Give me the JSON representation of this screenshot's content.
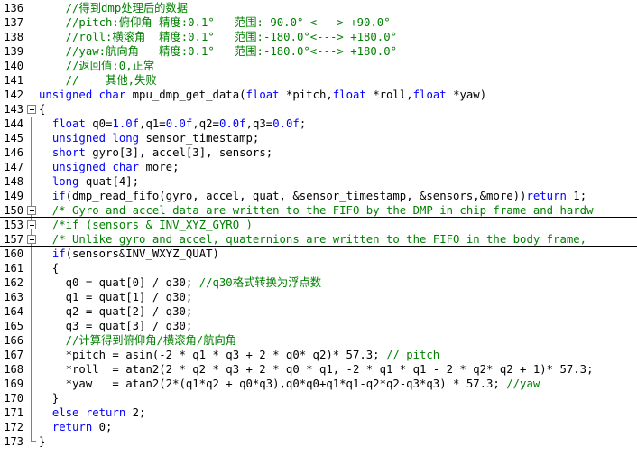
{
  "editor": {
    "lines": [
      {
        "n": "136",
        "fold": "line",
        "tokens": [
          {
            "t": "    //得到dmp处理后的数据",
            "c": "cm"
          }
        ]
      },
      {
        "n": "137",
        "fold": "line",
        "tokens": [
          {
            "t": "    //pitch:俯仰角 精度:0.1°   范围:-90.0° <---> +90.0°",
            "c": "cm"
          }
        ]
      },
      {
        "n": "138",
        "fold": "line",
        "tokens": [
          {
            "t": "    //roll:横滚角  精度:0.1°   范围:-180.0°<---> +180.0°",
            "c": "cm"
          }
        ]
      },
      {
        "n": "139",
        "fold": "line",
        "tokens": [
          {
            "t": "    //yaw:航向角   精度:0.1°   范围:-180.0°<---> +180.0°",
            "c": "cm"
          }
        ]
      },
      {
        "n": "140",
        "fold": "line",
        "tokens": [
          {
            "t": "    //返回值:0,正常",
            "c": "cm"
          }
        ]
      },
      {
        "n": "141",
        "fold": "line",
        "tokens": [
          {
            "t": "    //    其他,失败",
            "c": "cm"
          }
        ]
      },
      {
        "n": "142",
        "fold": "line",
        "tokens": [
          {
            "t": "unsigned char",
            "c": "kw"
          },
          {
            "t": " mpu_dmp_get_data(",
            "c": ""
          },
          {
            "t": "float",
            "c": "kw"
          },
          {
            "t": " *pitch,",
            "c": ""
          },
          {
            "t": "float",
            "c": "kw"
          },
          {
            "t": " *roll,",
            "c": ""
          },
          {
            "t": "float",
            "c": "kw"
          },
          {
            "t": " *yaw)",
            "c": ""
          }
        ]
      },
      {
        "n": "143",
        "fold": "open",
        "tokens": [
          {
            "t": "{",
            "c": ""
          }
        ]
      },
      {
        "n": "144",
        "fold": "line",
        "tokens": [
          {
            "t": "  ",
            "c": ""
          },
          {
            "t": "float",
            "c": "kw"
          },
          {
            "t": " q0=",
            "c": ""
          },
          {
            "t": "1.0f",
            "c": "kw"
          },
          {
            "t": ",q1=",
            "c": ""
          },
          {
            "t": "0.0f",
            "c": "kw"
          },
          {
            "t": ",q2=",
            "c": ""
          },
          {
            "t": "0.0f",
            "c": "kw"
          },
          {
            "t": ",q3=",
            "c": ""
          },
          {
            "t": "0.0f",
            "c": "kw"
          },
          {
            "t": ";",
            "c": ""
          }
        ]
      },
      {
        "n": "145",
        "fold": "line",
        "tokens": [
          {
            "t": "  ",
            "c": ""
          },
          {
            "t": "unsigned long",
            "c": "kw"
          },
          {
            "t": " sensor_timestamp;",
            "c": ""
          }
        ]
      },
      {
        "n": "146",
        "fold": "line",
        "tokens": [
          {
            "t": "  ",
            "c": ""
          },
          {
            "t": "short",
            "c": "kw"
          },
          {
            "t": " gyro[3], accel[3], sensors;",
            "c": ""
          }
        ]
      },
      {
        "n": "147",
        "fold": "line",
        "tokens": [
          {
            "t": "  ",
            "c": ""
          },
          {
            "t": "unsigned char",
            "c": "kw"
          },
          {
            "t": " more;",
            "c": ""
          }
        ]
      },
      {
        "n": "148",
        "fold": "line",
        "tokens": [
          {
            "t": "  ",
            "c": ""
          },
          {
            "t": "long",
            "c": "kw"
          },
          {
            "t": " quat[4];",
            "c": ""
          }
        ]
      },
      {
        "n": "149",
        "fold": "line",
        "tokens": [
          {
            "t": "  ",
            "c": ""
          },
          {
            "t": "if",
            "c": "kw"
          },
          {
            "t": "(dmp_read_fifo(gyro, accel, quat, &sensor_timestamp, &sensors,&more))",
            "c": ""
          },
          {
            "t": "return",
            "c": "kw"
          },
          {
            "t": " 1;",
            "c": ""
          }
        ]
      },
      {
        "n": "150",
        "fold": "closed",
        "sep": true,
        "tokens": [
          {
            "t": "  /* Gyro and accel data are written to the FIFO by the DMP in chip frame and hardw",
            "c": "cm"
          }
        ]
      },
      {
        "n": "153",
        "fold": "closed",
        "sep": false,
        "tokens": [
          {
            "t": "  /*if (sensors & INV_XYZ_GYRO )",
            "c": "cm"
          }
        ]
      },
      {
        "n": "157",
        "fold": "closed",
        "sep": true,
        "tokens": [
          {
            "t": "  /* Unlike gyro and accel, quaternions are written to the FIFO in the body frame, ",
            "c": "cm"
          }
        ]
      },
      {
        "n": "160",
        "fold": "line",
        "tokens": [
          {
            "t": "  ",
            "c": ""
          },
          {
            "t": "if",
            "c": "kw"
          },
          {
            "t": "(sensors&INV_WXYZ_QUAT)",
            "c": ""
          }
        ]
      },
      {
        "n": "161",
        "fold": "line",
        "tokens": [
          {
            "t": "  {",
            "c": ""
          }
        ]
      },
      {
        "n": "162",
        "fold": "line",
        "tokens": [
          {
            "t": "    q0 = quat[0] / q30; ",
            "c": ""
          },
          {
            "t": "//q30格式转换为浮点数",
            "c": "cm"
          }
        ]
      },
      {
        "n": "163",
        "fold": "line",
        "tokens": [
          {
            "t": "    q1 = quat[1] / q30;",
            "c": ""
          }
        ]
      },
      {
        "n": "164",
        "fold": "line",
        "tokens": [
          {
            "t": "    q2 = quat[2] / q30;",
            "c": ""
          }
        ]
      },
      {
        "n": "165",
        "fold": "line",
        "tokens": [
          {
            "t": "    q3 = quat[3] / q30;",
            "c": ""
          }
        ]
      },
      {
        "n": "166",
        "fold": "line",
        "tokens": [
          {
            "t": "    //计算得到俯仰角/横滚角/航向角",
            "c": "cm"
          }
        ]
      },
      {
        "n": "167",
        "fold": "line",
        "tokens": [
          {
            "t": "    *pitch = asin(-2 * q1 * q3 + 2 * q0* q2)* 57.3; ",
            "c": ""
          },
          {
            "t": "// pitch",
            "c": "cm"
          }
        ]
      },
      {
        "n": "168",
        "fold": "line",
        "tokens": [
          {
            "t": "    *roll  = atan2(2 * q2 * q3 + 2 * q0 * q1, -2 * q1 * q1 - 2 * q2* q2 + 1)* 57.3;",
            "c": ""
          }
        ]
      },
      {
        "n": "169",
        "fold": "line",
        "tokens": [
          {
            "t": "    *yaw   = atan2(2*(q1*q2 + q0*q3),q0*q0+q1*q1-q2*q2-q3*q3) * 57.3; ",
            "c": ""
          },
          {
            "t": "//yaw",
            "c": "cm"
          }
        ]
      },
      {
        "n": "170",
        "fold": "line",
        "tokens": [
          {
            "t": "  }",
            "c": ""
          }
        ]
      },
      {
        "n": "171",
        "fold": "line",
        "tokens": [
          {
            "t": "  ",
            "c": ""
          },
          {
            "t": "else return",
            "c": "kw"
          },
          {
            "t": " 2;",
            "c": ""
          }
        ]
      },
      {
        "n": "172",
        "fold": "line",
        "tokens": [
          {
            "t": "  ",
            "c": ""
          },
          {
            "t": "return",
            "c": "kw"
          },
          {
            "t": " 0;",
            "c": ""
          }
        ]
      },
      {
        "n": "173",
        "fold": "end",
        "tokens": [
          {
            "t": "}",
            "c": ""
          }
        ]
      }
    ]
  },
  "colors": {
    "keyword": "#0000ff",
    "comment": "#008000",
    "text": "#000000",
    "background": "#ffffff"
  }
}
